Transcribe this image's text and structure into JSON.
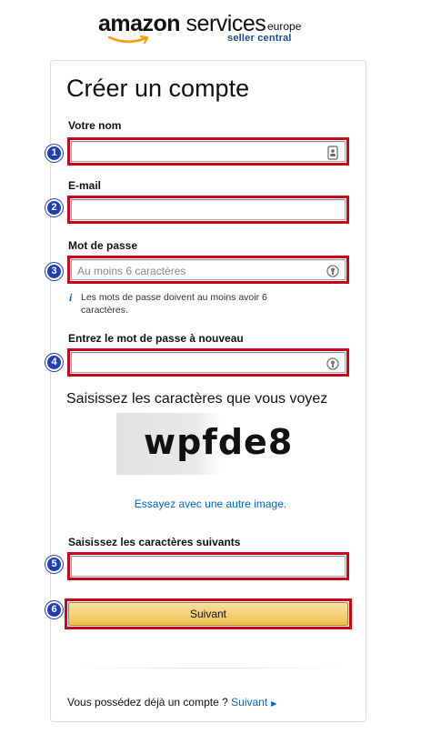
{
  "logo": {
    "brand": "amazon",
    "brand_suffix": "services",
    "region": "europe",
    "sub": "seller central"
  },
  "form": {
    "title": "Créer un compte",
    "name_label": "Votre nom",
    "email_label": "E-mail",
    "password_label": "Mot de passe",
    "password_placeholder": "Au moins 6 caractères",
    "password_hint": "Les mots de passe doivent au moins avoir 6 caractères.",
    "password_repeat_label": "Entrez le mot de passe à nouveau",
    "captcha_heading": "Saisissez les caractères que vous voyez",
    "captcha_text": "wpfde8",
    "captcha_other_image": "Essayez avec une autre image.",
    "captcha_input_label": "Saisissez les caractères suivants",
    "submit_label": "Suivant"
  },
  "footer": {
    "existing_account_text": "Vous possédez déjà un compte ?",
    "signin_link": "Suivant"
  },
  "badges": [
    "1",
    "2",
    "3",
    "4",
    "5",
    "6"
  ],
  "colors": {
    "highlight": "#d0021b",
    "badge": "#1f3fb3",
    "link": "#0066c0",
    "button": "#f0c14b"
  }
}
